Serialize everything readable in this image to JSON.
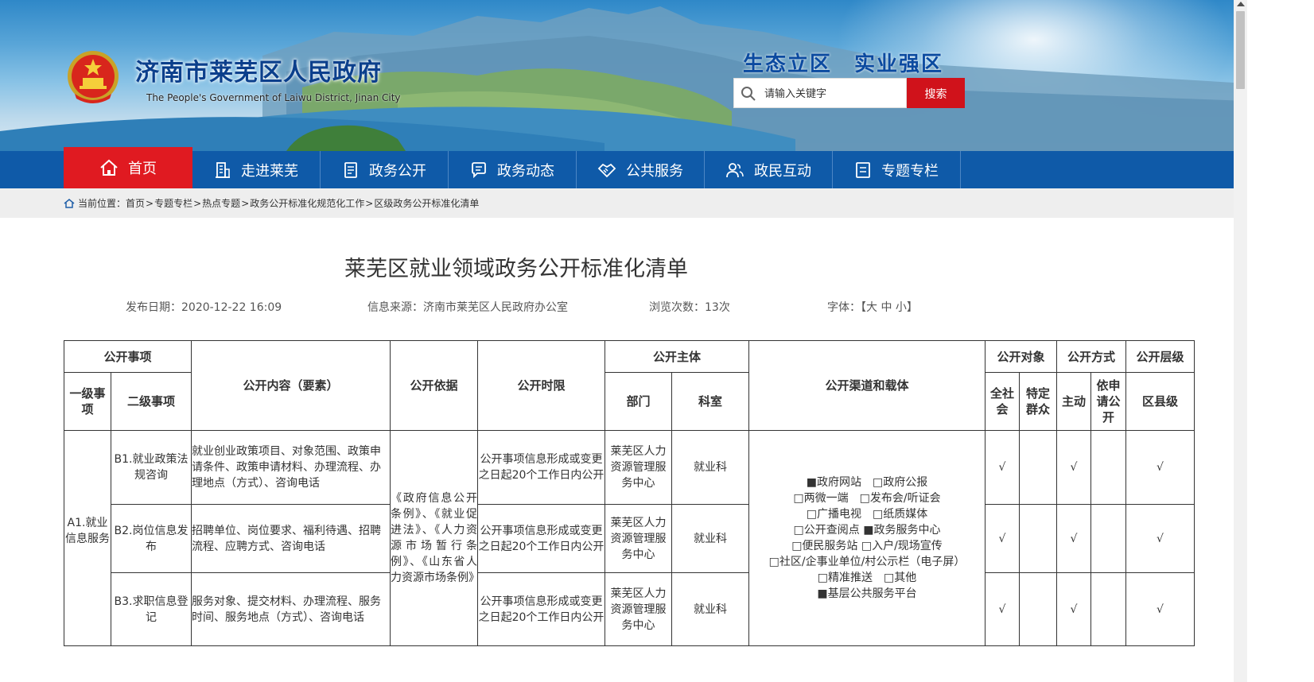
{
  "header": {
    "site_title": "济南市莱芜区人民政府",
    "site_subtitle": "The People's Government of Laiwu District, Jinan City",
    "slogan": "生态立区　实业强区",
    "search_placeholder": "请输入关键字",
    "search_button": "搜索"
  },
  "nav": {
    "items": [
      {
        "label": "首页",
        "icon": "home-icon"
      },
      {
        "label": "走进莱芜",
        "icon": "building-icon"
      },
      {
        "label": "政务公开",
        "icon": "document-icon"
      },
      {
        "label": "政务动态",
        "icon": "chat-icon"
      },
      {
        "label": "公共服务",
        "icon": "handshake-icon"
      },
      {
        "label": "政民互动",
        "icon": "people-icon"
      },
      {
        "label": "专题专栏",
        "icon": "list-icon"
      }
    ]
  },
  "breadcrumb": {
    "prefix": "当前位置：",
    "items": [
      "首页",
      "专题专栏",
      "热点专题",
      "政务公开标准化规范化工作",
      "区级政务公开标准化清单"
    ],
    "separator": ">"
  },
  "article": {
    "title": "莱芜区就业领域政务公开标准化清单",
    "publish_date": "发布日期：2020-12-22 16:09",
    "source": "信息来源：济南市莱芜区人民政府办公室",
    "views": "浏览次数：13次",
    "font_size": "字体：【大 中 小】"
  },
  "table": {
    "headers": {
      "item": "公开事项",
      "level1": "一级事项",
      "level2": "二级事项",
      "content": "公开内容（要素）",
      "basis": "公开依据",
      "time_limit": "公开时限",
      "subject": "公开主体",
      "dept": "部门",
      "office": "科室",
      "channel": "公开渠道和载体",
      "target": "公开对象",
      "target_all": "全社会",
      "target_specific": "特定群众",
      "method": "公开方式",
      "method_active": "主动",
      "method_apply": "依申请公开",
      "level": "公开层级",
      "level_county": "区县级"
    },
    "level1_value": "A1.就业信息服务",
    "basis_value": "《政府信息公开条例》、《就业促进法》、《人力资源市场暂行条例》、《山东省人力资源市场条例》",
    "channels": [
      "■政府网站　□政府公报",
      "□两微一端　□发布会/听证会",
      "□广播电视　□纸质媒体",
      "□公开查阅点 ■政务服务中心",
      "□便民服务站 □入户/现场宣传",
      "□社区/企事业单位/村公示栏（电子屏）",
      "□精准推送　□其他",
      "■基层公共服务平台"
    ],
    "rows": [
      {
        "level2": "B1.就业政策法规咨询",
        "content": "就业创业政策项目、对象范围、政策申请条件、政策申请材料、办理流程、办理地点（方式）、咨询电话",
        "time_limit": "公开事项信息形成或变更之日起20个工作日内公开",
        "dept": "莱芜区人力资源管理服务中心",
        "office": "就业科",
        "all": "√",
        "specific": "",
        "active": "√",
        "apply": "",
        "county": "√"
      },
      {
        "level2": "B2.岗位信息发布",
        "content": "招聘单位、岗位要求、福利待遇、招聘流程、应聘方式、咨询电话",
        "time_limit": "公开事项信息形成或变更之日起20个工作日内公开",
        "dept": "莱芜区人力资源管理服务中心",
        "office": "就业科",
        "all": "√",
        "specific": "",
        "active": "√",
        "apply": "",
        "county": "√"
      },
      {
        "level2": "B3.求职信息登记",
        "content": "服务对象、提交材料、办理流程、服务时间、服务地点（方式）、咨询电话",
        "time_limit": "公开事项信息形成或变更之日起20个工作日内公开",
        "dept": "莱芜区人力资源管理服务中心",
        "office": "就业科",
        "all": "√",
        "specific": "",
        "active": "√",
        "apply": "",
        "county": "√"
      }
    ]
  },
  "colors": {
    "nav_blue": "#0f5aa8",
    "nav_active_red": "#e01a21",
    "search_red": "#d0121b",
    "title_blue": "#0b3f8c"
  }
}
